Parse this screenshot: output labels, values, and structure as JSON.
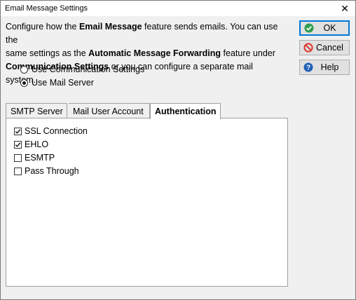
{
  "window": {
    "title": "Email Message Settings",
    "close_glyph": "✕"
  },
  "intro": {
    "line1_pre": "Configure how the ",
    "line1_bold": "Email Message",
    "line1_post": " feature sends emails.  You can use the",
    "line2_pre": "same settings as the ",
    "line2_bold": "Automatic Message Forwarding",
    "line2_post": " feature under",
    "line3_bold": "Communication Settings",
    "line3_post": " or you can configure a separate mail system."
  },
  "mail_source": {
    "options": [
      {
        "label": "Use Communication Settings",
        "selected": false
      },
      {
        "label": "Use Mail Server",
        "selected": true
      }
    ]
  },
  "buttons": {
    "ok": {
      "label": "OK",
      "icon": "check-circle-icon",
      "color": "#2e9e4f"
    },
    "cancel": {
      "label": "Cancel",
      "icon": "no-entry-icon",
      "color": "#d9342b"
    },
    "help": {
      "label": "Help",
      "icon": "question-circle-icon",
      "color": "#1f5fb7"
    }
  },
  "tabs": [
    {
      "label": "SMTP Server",
      "active": false
    },
    {
      "label": "Mail User Account",
      "active": false
    },
    {
      "label": "Authentication",
      "active": true
    }
  ],
  "authentication": {
    "options": [
      {
        "label": "SSL Connection",
        "checked": true
      },
      {
        "label": "EHLO",
        "checked": true
      },
      {
        "label": "ESMTP",
        "checked": false
      },
      {
        "label": "Pass Through",
        "checked": false
      }
    ]
  },
  "colors": {
    "accent": "#0078d7",
    "dialog_bg": "#f0f0f0",
    "panel_bg": "#ffffff"
  }
}
